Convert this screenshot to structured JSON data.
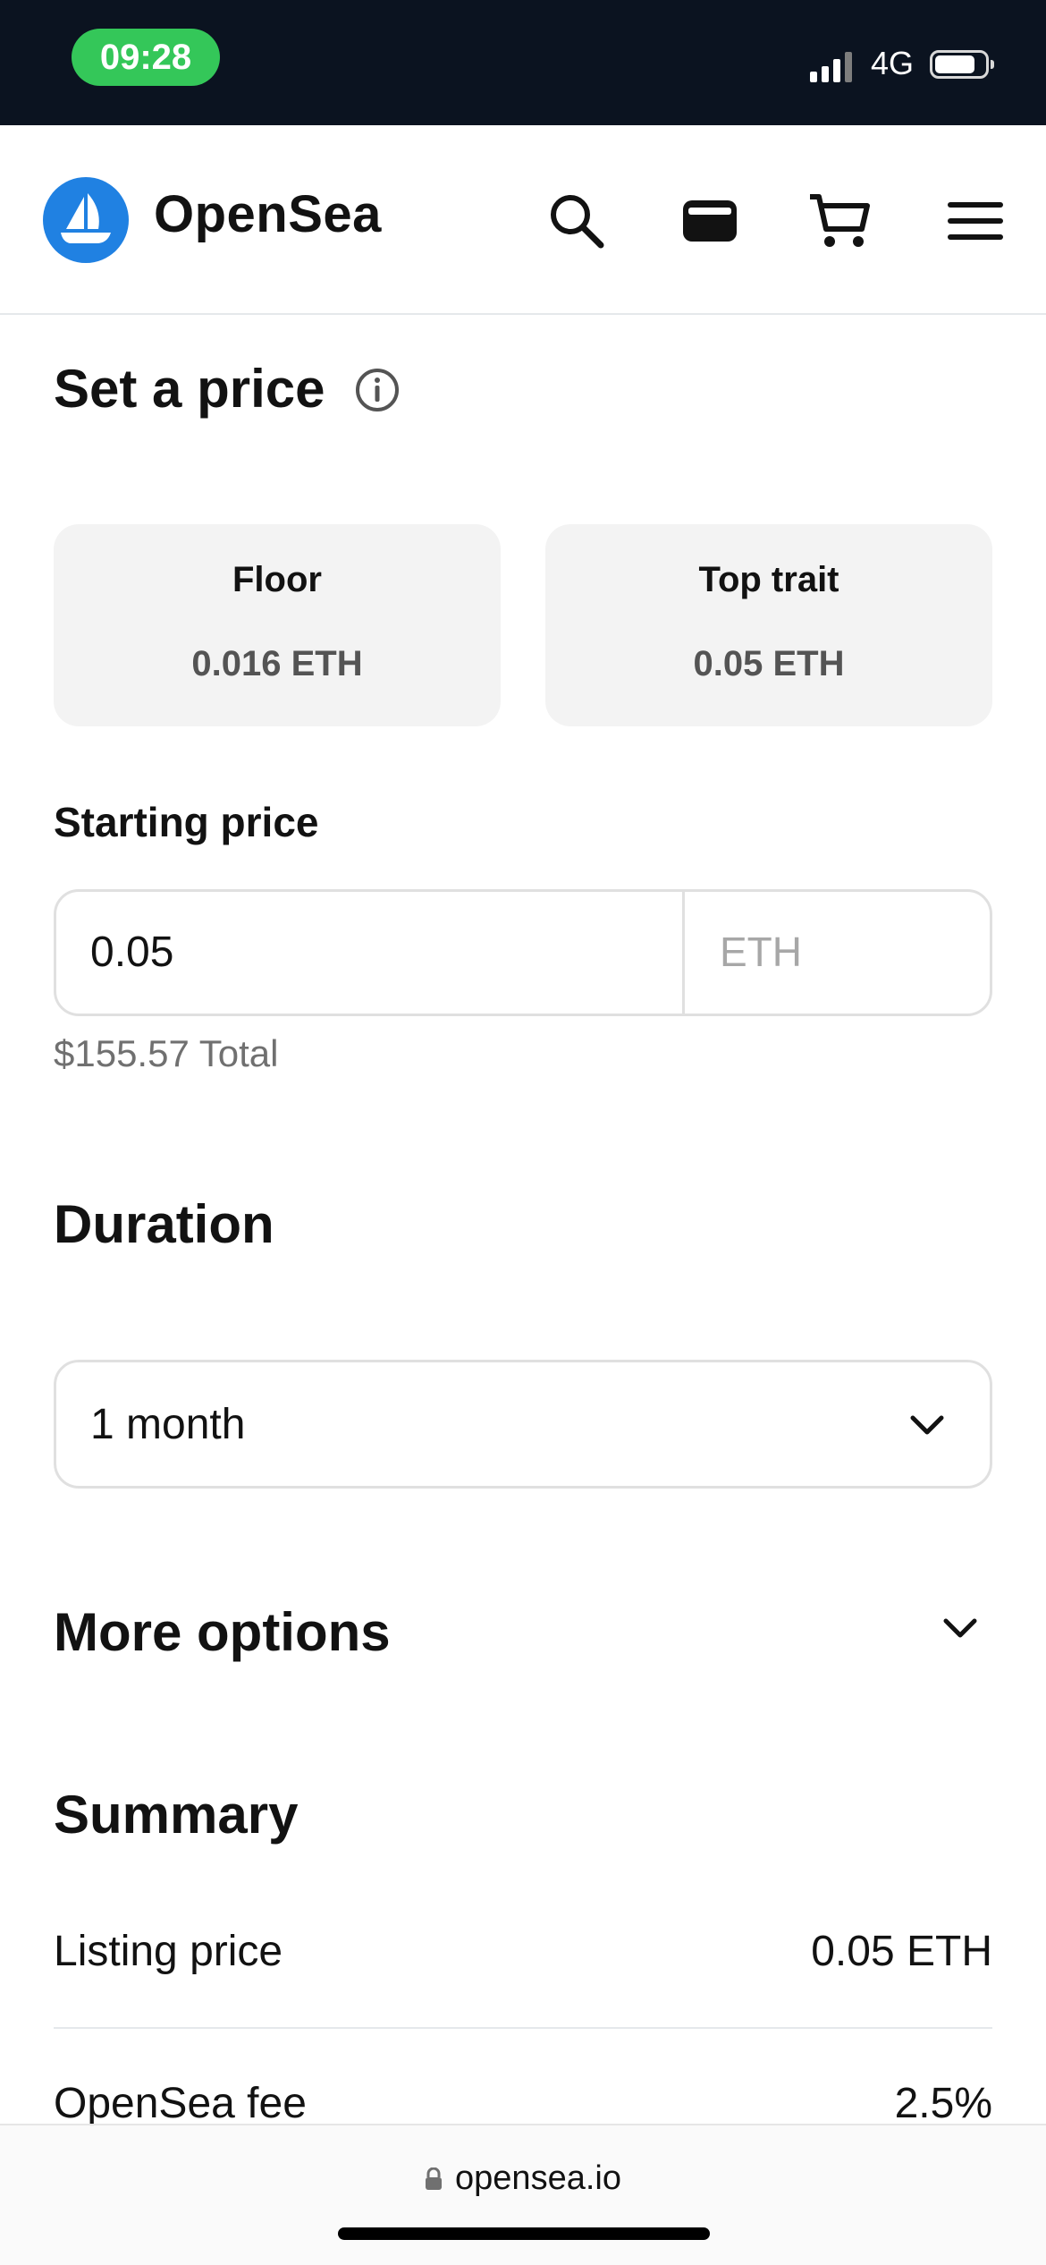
{
  "status_bar": {
    "time": "09:28",
    "network": "4G"
  },
  "header": {
    "brand": "OpenSea",
    "icons": [
      "search-icon",
      "wallet-icon",
      "cart-icon",
      "menu-icon"
    ]
  },
  "set_price": {
    "title": "Set a price",
    "cards": [
      {
        "label": "Floor",
        "value": "0.016 ETH"
      },
      {
        "label": "Top trait",
        "value": "0.05 ETH"
      }
    ],
    "starting_price_label": "Starting price",
    "starting_price_value": "0.05",
    "currency": "ETH",
    "total": "$155.57 Total"
  },
  "duration": {
    "title": "Duration",
    "selected": "1 month"
  },
  "more_options": {
    "title": "More options"
  },
  "summary": {
    "title": "Summary",
    "rows": [
      {
        "label": "Listing price",
        "value": "0.05 ETH"
      },
      {
        "label": "OpenSea fee",
        "value": "2.5%"
      }
    ]
  },
  "browser": {
    "url": "opensea.io"
  },
  "colors": {
    "brand_blue": "#2081e2",
    "status_green": "#34c759",
    "status_bar_bg": "#0b1320"
  }
}
